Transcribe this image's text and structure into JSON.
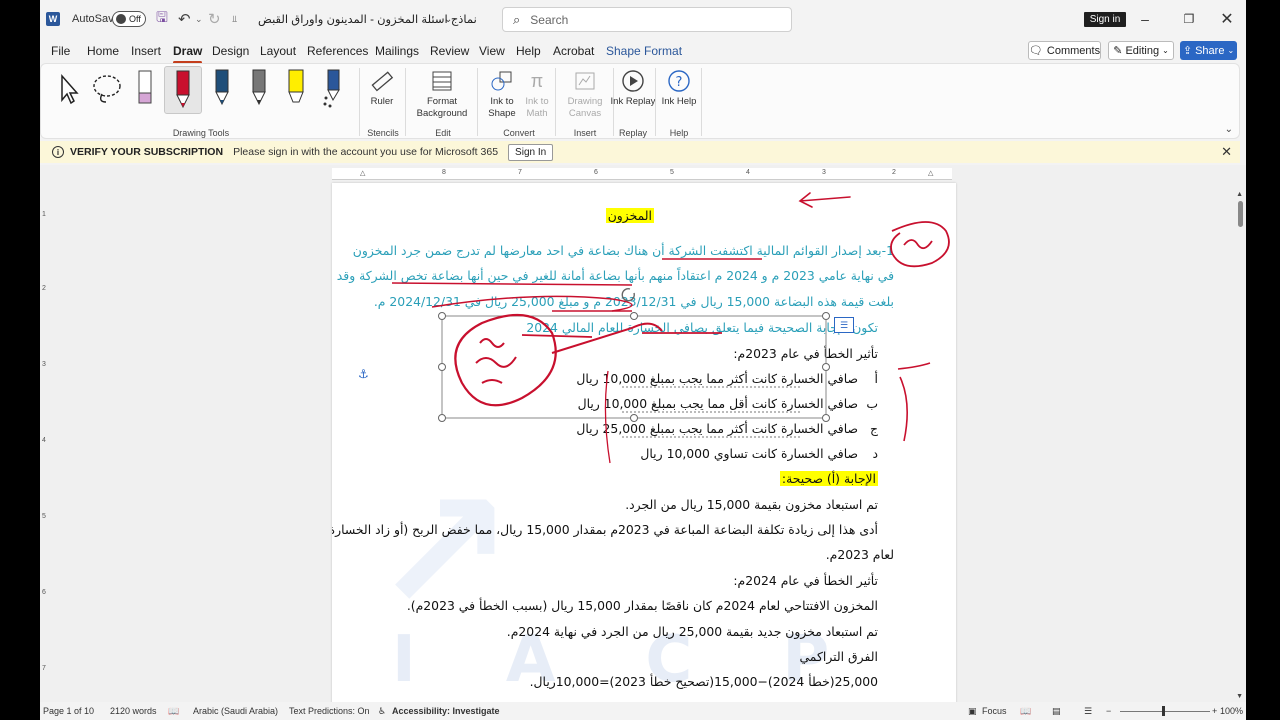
{
  "titlebar": {
    "autosave_label": "AutoSave",
    "autosave_state": "Off",
    "doc_title": "نماذج اسئلة المخزون - المدينون واوراق القبض",
    "search_placeholder": "Search",
    "signin_label": "Sign in"
  },
  "tabs": [
    "File",
    "Home",
    "Insert",
    "Draw",
    "Design",
    "Layout",
    "References",
    "Mailings",
    "Review",
    "View",
    "Help",
    "Acrobat",
    "Shape Format"
  ],
  "active_tab": "Draw",
  "actions": {
    "comments": "Comments",
    "editing": "Editing",
    "share": "Share"
  },
  "ribbon": {
    "drawing_tools_label": "Drawing Tools",
    "ruler_label": "Ruler",
    "stencils_label": "Stencils",
    "format_background_label": "Format Background",
    "edit_label": "Edit",
    "ink_to_shape_label": "Ink to Shape",
    "ink_to_math_label": "Ink to Math",
    "convert_label": "Convert",
    "drawing_canvas_label": "Drawing Canvas",
    "insert_label": "Insert",
    "ink_replay_label": "Ink Replay",
    "replay_label": "Replay",
    "ink_help_label": "Ink Help",
    "help_label": "Help"
  },
  "message_bar": {
    "title": "VERIFY YOUR SUBSCRIPTION",
    "text": "Please sign in with the account you use for Microsoft 365",
    "button": "Sign In"
  },
  "ruler_numbers": [
    "1",
    "2",
    "3",
    "4",
    "5",
    "6",
    "7",
    "8"
  ],
  "vruler_numbers": [
    "1",
    "2",
    "3",
    "4",
    "5",
    "6",
    "7"
  ],
  "document": {
    "heading": "المخزون",
    "question_lines": [
      "1-بعد إصدار القوائم المالية اكتشفت الشركة أن هناك بضاعة في احد معارضها لم تدرج ضمن جرد المخزون",
      "في نهاية عامي 2023 م و 2024 م اعتقاداً منهم بأنها بضاعة أمانة للغير في حين أنها بضاعة تخص الشركة وقد",
      "بلغت قيمة هذه البضاعة 15,000 ريال في 2023/12/31 م و مبلغ 25,000 ريال في 2024/12/31 م.",
      "تكون الإجابة الصحيحة فيما يتعلق بصافي الخسارة للعام المالي 2024"
    ],
    "effect_2023_title": "تأثير الخطأ في عام 2023م:",
    "options": [
      {
        "letter": "أ",
        "text": "صافي الخسارة كانت أكثر مما يجب بمبلغ 10,000 ريال"
      },
      {
        "letter": "ب",
        "text": "صافي الخسارة كانت أقل مما يجب بمبلغ 10,000 ريال"
      },
      {
        "letter": "ج",
        "text": "صافي الخسارة كانت أكثر مما يجب بمبلغ 25,000 ريال"
      },
      {
        "letter": "د",
        "text": "صافي الخسارة كانت تساوي 10,000 ريال"
      }
    ],
    "answer": "الإجابة (أ) صحيحة:",
    "explanation_lines": [
      "تم استبعاد مخزون بقيمة 15,000 ريال من الجرد.",
      "أدى هذا إلى زيادة تكلفة البضاعة المباعة في 2023م بمقدار 15,000 ريال، مما خفض الربح (أو زاد الخسارة)",
      "لعام 2023م.",
      "تأثير الخطأ في عام 2024م:",
      "المخزون الافتتاحي لعام 2024م كان ناقصًا بمقدار 15,000 ريال (بسبب الخطأ في 2023م).",
      "تم استبعاد مخزون جديد بقيمة 25,000 ريال من الجرد في نهاية 2024م.",
      "الفرق التراكمي",
      "25,000(خطأ 2024)−15,000(تصحيح خطأ 2023)=10,000ريال."
    ],
    "watermark": "IACP"
  },
  "statusbar": {
    "page": "Page 1 of 10",
    "words": "2120 words",
    "language": "Arabic (Saudi Arabia)",
    "text_predictions": "Text Predictions: On",
    "accessibility": "Accessibility: Investigate",
    "focus": "Focus",
    "zoom": "100%"
  },
  "colors": {
    "accent_tab": "#c43e1c",
    "ink_red": "#c8102e",
    "question_text": "#2a9fb8",
    "highlight": "#ffff00",
    "share": "#2b67c4"
  }
}
